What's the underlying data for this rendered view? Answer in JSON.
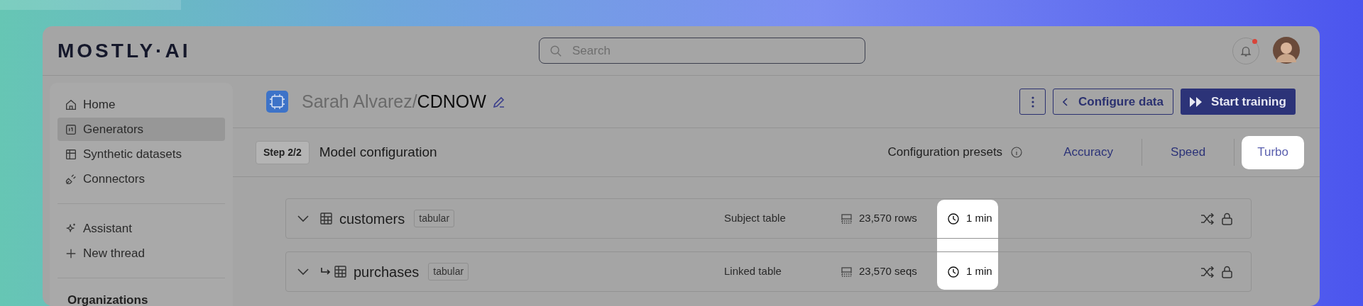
{
  "header": {
    "logo": "MOSTLY·AI",
    "search": {
      "placeholder": "Search"
    },
    "notifications": {
      "unread": true
    }
  },
  "sidebar": {
    "items": [
      {
        "label": "Home",
        "selected": false
      },
      {
        "label": "Generators",
        "selected": true
      },
      {
        "label": "Synthetic datasets",
        "selected": false
      },
      {
        "label": "Connectors",
        "selected": false
      }
    ],
    "assistant_items": [
      "Assistant",
      "New thread"
    ],
    "section_heading": "Organizations"
  },
  "page": {
    "owner": "Sarah Alvarez/",
    "name": "CDNOW",
    "actions": [
      "Configure data",
      "Start training"
    ]
  },
  "step": {
    "badge": "Step 2/2",
    "title": "Model configuration"
  },
  "presets": {
    "label": "Configuration presets",
    "options": [
      {
        "label": "Accuracy",
        "selected": false
      },
      {
        "label": "Speed",
        "selected": false
      },
      {
        "label": "Turbo",
        "selected": true
      }
    ]
  },
  "tables": [
    {
      "kind": "subject",
      "name": "customers",
      "badge": "tabular",
      "role": "Subject table",
      "size": "23,570 rows",
      "time": "1 min"
    },
    {
      "kind": "linked",
      "name": "purchases",
      "badge": "tabular",
      "role": "Linked table",
      "size": "23,570 seqs",
      "time": "1 min"
    }
  ]
}
